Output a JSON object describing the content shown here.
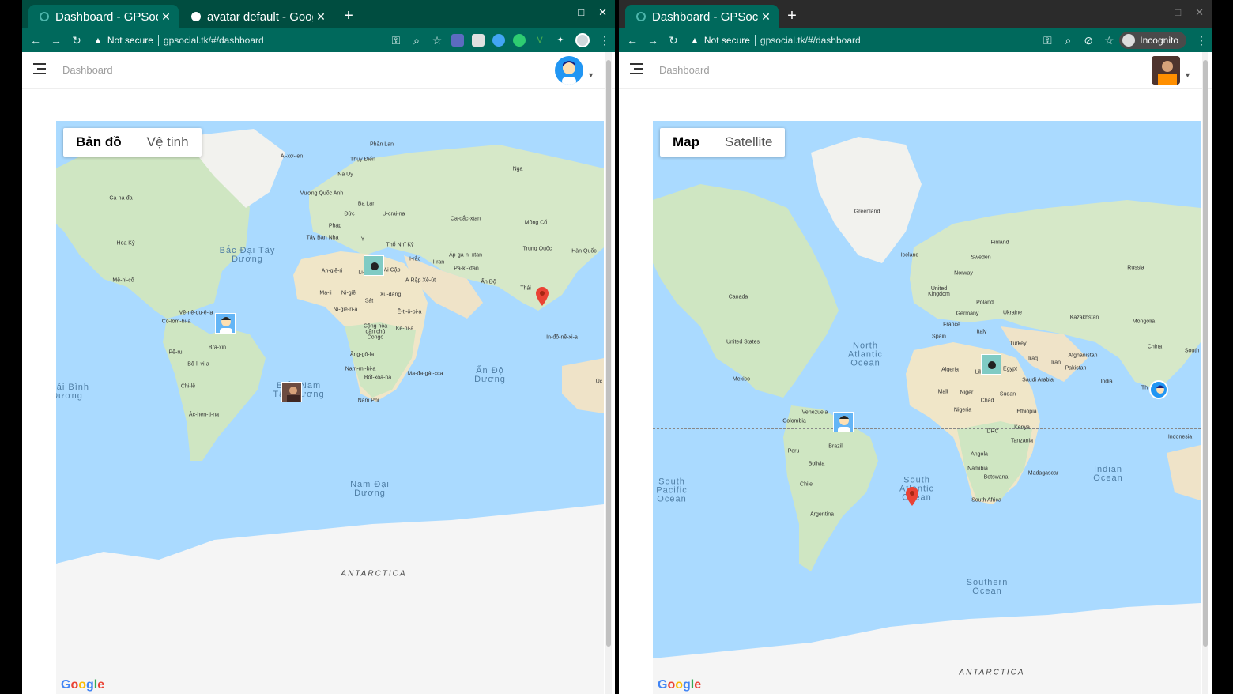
{
  "left": {
    "tabs": [
      {
        "title": "Dashboard - GPSocial",
        "active": true
      },
      {
        "title": "avatar default - Google",
        "active": false
      }
    ],
    "security": "Not secure",
    "url": "gpsocial.tk/#/dashboard",
    "breadcrumb": "Dashboard",
    "map_type": {
      "map": "Bản đồ",
      "satellite": "Vệ tinh"
    },
    "labels": {
      "canada": "Ca-na-đa",
      "usa": "Hoa Kỳ",
      "mexico": "Mê-hi-cô",
      "venezuela": "Vê-nê-du-ê-la",
      "colombia": "Cô-lôm-bi-a",
      "brazil": "Bra-xin",
      "peru": "Pê-ru",
      "bolivia": "Bô-li-vi-a",
      "chile": "Chi-lê",
      "argentina": "Ác-hen-ti-na",
      "iceland": "Ai-xơ-len",
      "finland": "Phần Lan",
      "sweden": "Thụy Điển",
      "norway": "Na Uy",
      "uk": "Vương Quốc Anh",
      "poland": "Ba Lan",
      "germany": "Đức",
      "ukraine": "U-crai-na",
      "france": "Pháp",
      "spain": "Tây Ban Nha",
      "italy": "Ý",
      "turkey": "Thổ Nhĩ Kỳ",
      "kazakhstan": "Ca-dắc-xtan",
      "mongolia": "Mông Cổ",
      "russia": "Nga",
      "china": "Trung Quốc",
      "korea": "Hàn Quốc",
      "afghanistan": "Áp-ga-ni-xtan",
      "iran": "I-ran",
      "iraq": "I-rắc",
      "pakistan": "Pa-ki-xtan",
      "india": "Ấn Độ",
      "thailand": "Thái",
      "indonesia": "In-đô-nê-xi-a",
      "algeria": "An-giê-ri",
      "libya": "Li-bi",
      "egypt": "Ai Cập",
      "saudi": "Ả Rập Xê-út",
      "mali": "Ma-li",
      "niger": "Ni-giê",
      "chad": "Sát",
      "sudan": "Xu-đăng",
      "nigeria": "Ni-giê-ri-a",
      "ethiopia": "Ê-ti-ô-pi-a",
      "congo": "Cộng hòa dân chủ Congo",
      "kenya": "Kê-ni-a",
      "angola": "Ăng-gô-la",
      "namibia": "Nam-mi-bi-a",
      "botswana": "Bốt-xoa-na",
      "madagascar": "Ma-đa-gát-xca",
      "south_africa": "Nam Phi",
      "australia": "Úc"
    },
    "oceans": {
      "north_atlantic": "Bắc Đại Tây Dương",
      "south_atlantic": "Biển Nam Tây Dương",
      "indian": "Ấn Độ Dương",
      "southern": "Nam Đại Dương",
      "pacific": "Thái Bình Dương",
      "antarctica": "ANTARCTICA"
    }
  },
  "right": {
    "tabs": [
      {
        "title": "Dashboard - GPSocial",
        "active": true
      }
    ],
    "security": "Not secure",
    "url": "gpsocial.tk/#/dashboard",
    "incognito": "Incognito",
    "breadcrumb": "Dashboard",
    "map_type": {
      "map": "Map",
      "satellite": "Satellite"
    },
    "labels": {
      "greenland": "Greenland",
      "iceland": "Iceland",
      "finland": "Finland",
      "sweden": "Sweden",
      "norway": "Norway",
      "russia": "Russia",
      "uk": "United Kingdom",
      "poland": "Poland",
      "germany": "Germany",
      "ukraine": "Ukraine",
      "kazakhstan": "Kazakhstan",
      "mongolia": "Mongolia",
      "france": "France",
      "spain": "Spain",
      "italy": "Italy",
      "turkey": "Turkey",
      "china": "China",
      "south": "South",
      "canada": "Canada",
      "usa": "United States",
      "mexico": "Mexico",
      "afghanistan": "Afghanistan",
      "iraq": "Iraq",
      "iran": "Iran",
      "pakistan": "Pakistan",
      "algeria": "Algeria",
      "libya": "Libya",
      "egypt": "Egypt",
      "saudi": "Saudi Arabia",
      "india": "India",
      "mali": "Mali",
      "niger": "Niger",
      "sudan": "Sudan",
      "chad": "Chad",
      "nigeria": "Nigeria",
      "ethiopia": "Ethiopia",
      "venezuela": "Venezuela",
      "colombia": "Colombia",
      "drc": "DRC",
      "kenya": "Kenya",
      "tanzania": "Tanzania",
      "indonesia": "Indonesia",
      "brazil": "Brazil",
      "peru": "Peru",
      "bolivia": "Bolivia",
      "angola": "Angola",
      "namibia": "Namibia",
      "botswana": "Botswana",
      "madagascar": "Madagascar",
      "chile": "Chile",
      "south_africa": "South Africa",
      "argentina": "Argentina",
      "thailand": "Th"
    },
    "oceans": {
      "north_atlantic": "North Atlantic Ocean",
      "south_atlantic": "South Atlantic Ocean",
      "south_pacific": "South Pacific Ocean",
      "indian": "Indian Ocean",
      "southern": "Southern Ocean",
      "antarctica": "ANTARCTICA"
    }
  },
  "google_logo": "Google"
}
